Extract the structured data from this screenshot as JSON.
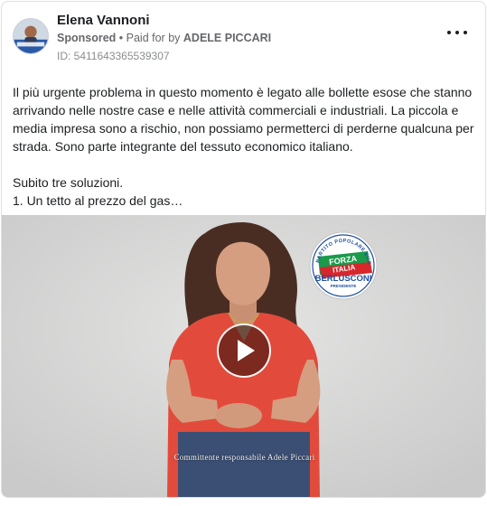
{
  "post": {
    "author_name": "Elena Vannoni",
    "sponsored_label": "Sponsored",
    "paid_for_prefix": "Paid for by",
    "payer": "ADELE PICCARI",
    "ad_id": "ID: 5411643365539307",
    "more_icon": "more-horizontal-icon",
    "text_lines": [
      "Il più urgente problema in questo momento è legato alle bollette esose che stanno",
      "arrivando nelle nostre case e nelle attività commerciali e industriali. La piccola e",
      "media impresa sono a rischio, non possiamo permetterci di perderne qualcuna per",
      "strada. Sono parte integrante del tessuto economico italiano."
    ],
    "text_lines_2": [
      "Subito tre soluzioni.",
      "1. Un tetto al prezzo del gas…"
    ]
  },
  "video": {
    "play_icon": "play-icon",
    "caption": "Committente responsabile Adele Piccari",
    "logo": {
      "arc_text": "PARTITO POPOLARE EUROPEO",
      "brand_top": "FORZA",
      "brand_bottom": "ITALIA",
      "name": "BERLUSCONI",
      "subtitle": "PRESIDENTE"
    }
  },
  "colors": {
    "text": "#1c1e21",
    "secondary": "#65676b",
    "logo_blue": "#1f4e9c",
    "logo_green": "#1b9a4b",
    "logo_red": "#d7262c",
    "blouse": "#e24b3b"
  }
}
